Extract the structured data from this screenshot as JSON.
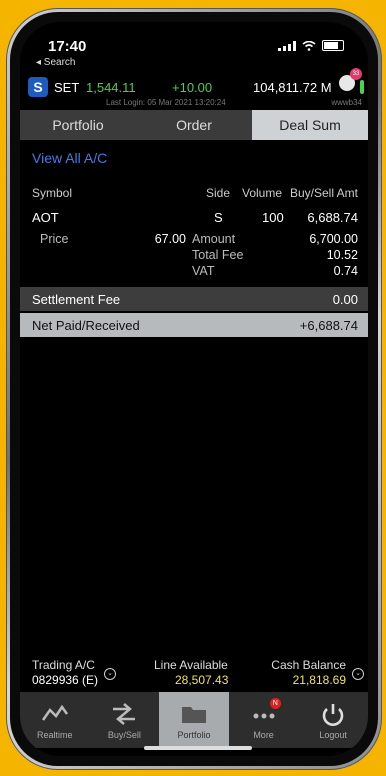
{
  "status": {
    "time": "17:40",
    "back_label": "◂ Search"
  },
  "ticker": {
    "market": "SET",
    "index": "1,544.11",
    "change": "+10.00",
    "volume": "104,811.72 M",
    "badge": "33"
  },
  "session": {
    "last_login": "Last Login: 05 Mar 2021 13:20:24",
    "user": "wwwb34"
  },
  "tabs": [
    {
      "label": "Portfolio"
    },
    {
      "label": "Order"
    },
    {
      "label": "Deal Sum"
    }
  ],
  "view_all_label": "View All A/C",
  "table": {
    "headers": {
      "symbol": "Symbol",
      "side": "Side",
      "volume": "Volume",
      "amt": "Buy/Sell Amt"
    },
    "row": {
      "symbol": "AOT",
      "side": "S",
      "volume": "100",
      "amt": "6,688.74"
    },
    "details": {
      "price_label": "Price",
      "price": "67.00",
      "amount_label": "Amount",
      "amount": "6,700.00",
      "fee_label": "Total Fee",
      "fee": "10.52",
      "vat_label": "VAT",
      "vat": "0.74"
    }
  },
  "settlement": {
    "label": "Settlement Fee",
    "value": "0.00"
  },
  "net": {
    "label": "Net Paid/Received",
    "value": "+6,688.74"
  },
  "footer": {
    "trading_label": "Trading A/C",
    "trading_value": "0829936 (E)",
    "line_label": "Line Available",
    "line_value": "28,507.43",
    "cash_label": "Cash Balance",
    "cash_value": "21,818.69"
  },
  "nav": [
    {
      "label": "Realtime"
    },
    {
      "label": "Buy/Sell"
    },
    {
      "label": "Portfolio"
    },
    {
      "label": "More",
      "badge": "N"
    },
    {
      "label": "Logout"
    }
  ],
  "colors": {
    "accent_green": "#4bd24b",
    "link_blue": "#4a78e6",
    "footer_yellow": "#f2e25a",
    "background": "#f5b400"
  }
}
